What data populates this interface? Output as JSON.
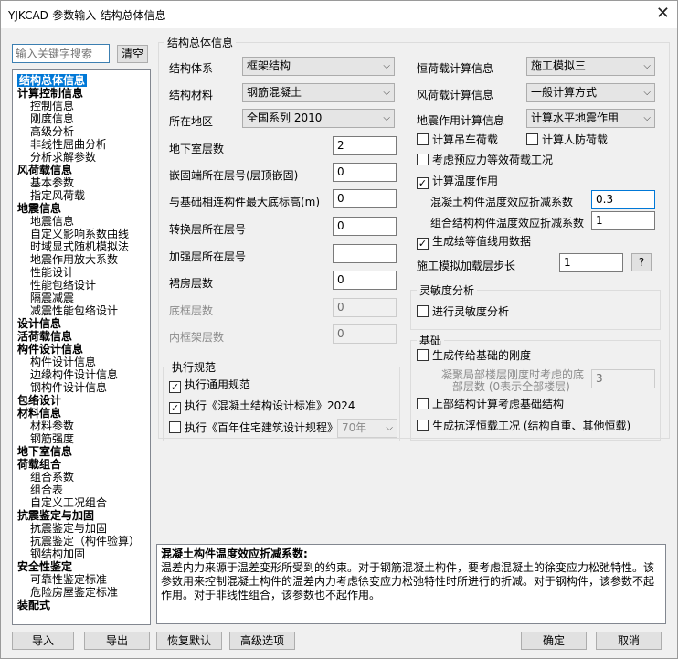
{
  "window": {
    "title": "YJKCAD-参数输入-结构总体信息",
    "close_glyph": "✕"
  },
  "search": {
    "placeholder": "输入关键字搜索",
    "clear_label": "清空"
  },
  "tree": [
    {
      "label": "结构总体信息",
      "level": 0,
      "selected": true
    },
    {
      "label": "计算控制信息",
      "level": 0
    },
    {
      "label": "控制信息",
      "level": 1
    },
    {
      "label": "刚度信息",
      "level": 1
    },
    {
      "label": "高级分析",
      "level": 1
    },
    {
      "label": "非线性屈曲分析",
      "level": 1
    },
    {
      "label": "分析求解参数",
      "level": 1
    },
    {
      "label": "风荷载信息",
      "level": 0
    },
    {
      "label": "基本参数",
      "level": 1
    },
    {
      "label": "指定风荷载",
      "level": 1
    },
    {
      "label": "地震信息",
      "level": 0
    },
    {
      "label": "地震信息",
      "level": 1
    },
    {
      "label": "自定义影响系数曲线",
      "level": 1
    },
    {
      "label": "时域显式随机模拟法",
      "level": 1
    },
    {
      "label": "地震作用放大系数",
      "level": 1
    },
    {
      "label": "性能设计",
      "level": 1
    },
    {
      "label": "性能包络设计",
      "level": 1
    },
    {
      "label": "隔震减震",
      "level": 1
    },
    {
      "label": "减震性能包络设计",
      "level": 1
    },
    {
      "label": "设计信息",
      "level": 0
    },
    {
      "label": "活荷载信息",
      "level": 0
    },
    {
      "label": "构件设计信息",
      "level": 0
    },
    {
      "label": "构件设计信息",
      "level": 1
    },
    {
      "label": "边缘构件设计信息",
      "level": 1
    },
    {
      "label": "钢构件设计信息",
      "level": 1
    },
    {
      "label": "包络设计",
      "level": 0
    },
    {
      "label": "材料信息",
      "level": 0
    },
    {
      "label": "材料参数",
      "level": 1
    },
    {
      "label": "钢筋强度",
      "level": 1
    },
    {
      "label": "地下室信息",
      "level": 0
    },
    {
      "label": "荷载组合",
      "level": 0
    },
    {
      "label": "组合系数",
      "level": 1
    },
    {
      "label": "组合表",
      "level": 1
    },
    {
      "label": "自定义工况组合",
      "level": 1
    },
    {
      "label": "抗震鉴定与加固",
      "level": 0
    },
    {
      "label": "抗震鉴定与加固",
      "level": 1
    },
    {
      "label": "抗震鉴定（构件验算）",
      "level": 1
    },
    {
      "label": "钢结构加固",
      "level": 1
    },
    {
      "label": "安全性鉴定",
      "level": 0
    },
    {
      "label": "可靠性鉴定标准",
      "level": 1
    },
    {
      "label": "危险房屋鉴定标准",
      "level": 1
    },
    {
      "label": "装配式",
      "level": 0
    }
  ],
  "main": {
    "group_title": "结构总体信息",
    "struct_system_label": "结构体系",
    "struct_system_value": "框架结构",
    "struct_material_label": "结构材料",
    "struct_material_value": "钢筋混凝土",
    "region_label": "所在地区",
    "region_value": "全国系列 2010",
    "basement_label": "地下室层数",
    "basement_value": "2",
    "embed_label": "嵌固端所在层号(层顶嵌固)",
    "embed_value": "0",
    "base_height_label": "与基础相连构件最大底标高(m)",
    "base_height_value": "0",
    "transfer_label": "转换层所在层号",
    "transfer_value": "0",
    "strengthen_label": "加强层所在层号",
    "strengthen_value": "",
    "podium_label": "裙房层数",
    "podium_value": "0",
    "bottom_frame_label": "底框层数",
    "bottom_frame_value": "0",
    "inner_frame_label": "内框架层数",
    "inner_frame_value": "0",
    "dead_load_label": "恒荷载计算信息",
    "dead_load_value": "施工模拟三",
    "wind_label": "风荷载计算信息",
    "wind_value": "一般计算方式",
    "seismic_label": "地震作用计算信息",
    "seismic_value": "计算水平地震作用",
    "crane_label": "计算吊车荷载",
    "crane_checked": false,
    "civil_defense_label": "计算人防荷载",
    "civil_defense_checked": false,
    "prestress_label": "考虑预应力等效荷载工况",
    "prestress_checked": false,
    "temperature_label": "计算温度作用",
    "temperature_checked": true,
    "concrete_temp_label": "混凝土构件温度效应折减系数",
    "concrete_temp_value": "0.3",
    "composite_temp_label": "组合结构构件温度效应折减系数",
    "composite_temp_value": "1",
    "contour_label": "生成绘等值线用数据",
    "contour_checked": true,
    "construction_step_label": "施工模拟加载层步长",
    "construction_step_value": "1",
    "help_button_label": "?"
  },
  "code": {
    "group_title": "执行规范",
    "general_label": "执行通用规范",
    "general_checked": true,
    "concrete_code_label": "执行《混凝土结构设计标准》2024",
    "concrete_code_checked": true,
    "residential_label": "执行《百年住宅建筑设计规程》",
    "residential_checked": false,
    "residential_years": "70年"
  },
  "sensitivity": {
    "group_title": "灵敏度分析",
    "run_label": "进行灵敏度分析",
    "run_checked": false
  },
  "foundation": {
    "group_title": "基础",
    "stiffness_label": "生成传给基础的刚度",
    "stiffness_checked": false,
    "bottom_layers_label_1": "凝聚局部楼层刚度时考虑的底",
    "bottom_layers_label_2": "部层数 (0表示全部楼层)",
    "bottom_layers_value": "3",
    "upper_label": "上部结构计算考虑基础结构",
    "upper_checked": false,
    "antifloat_label": "生成抗浮恒载工况 (结构自重、其他恒载)",
    "antifloat_checked": false
  },
  "help": {
    "title": "混凝土构件温度效应折减系数:",
    "text": "温差内力来源于温差变形所受到的约束。对于钢筋混凝土构件，要考虑混凝土的徐变应力松弛特性。该参数用来控制混凝土构件的温差内力考虑徐变应力松弛特性时所进行的折减。对于钢构件，该参数不起作用。对于非线性组合，该参数也不起作用。"
  },
  "footer": {
    "import_label": "导入",
    "export_label": "导出",
    "restore_label": "恢复默认",
    "advanced_label": "高级选项",
    "ok_label": "确定",
    "cancel_label": "取消"
  },
  "icons": {
    "dropdown": "chevron-down-icon",
    "close": "close-icon",
    "check": "checkmark-icon"
  },
  "colors": {
    "selection": "#0078d7",
    "focus_border": "#0078d7"
  }
}
